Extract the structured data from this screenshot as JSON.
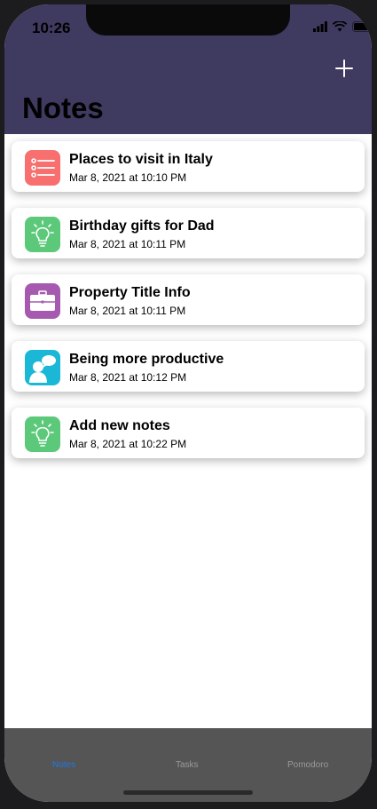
{
  "status_bar": {
    "time": "10:26"
  },
  "header": {
    "title": "Notes",
    "add_icon": "plus-icon"
  },
  "notes": [
    {
      "title": "Places to visit in Italy",
      "date": "Mar 8, 2021 at 10:10 PM",
      "icon": "list-icon",
      "color": "#f76f6f"
    },
    {
      "title": "Birthday gifts for Dad",
      "date": "Mar 8, 2021 at 10:11 PM",
      "icon": "lightbulb-icon",
      "color": "#5cc97a"
    },
    {
      "title": "Property Title Info",
      "date": "Mar 8, 2021 at 10:11 PM",
      "icon": "briefcase-icon",
      "color": "#a55ab0"
    },
    {
      "title": "Being more productive",
      "date": "Mar 8, 2021 at 10:12 PM",
      "icon": "person-thinking-icon",
      "color": "#1ab8d6"
    },
    {
      "title": "Add new notes",
      "date": "Mar 8, 2021 at 10:22 PM",
      "icon": "lightbulb-icon",
      "color": "#5cc97a"
    }
  ],
  "tabs": [
    {
      "label": "Notes",
      "active": true
    },
    {
      "label": "Tasks",
      "active": false
    },
    {
      "label": "Pomodoro",
      "active": false
    }
  ],
  "colors": {
    "header": "#3f3a5f",
    "tabbar": "#555555",
    "active_tab": "#1f78e6"
  }
}
